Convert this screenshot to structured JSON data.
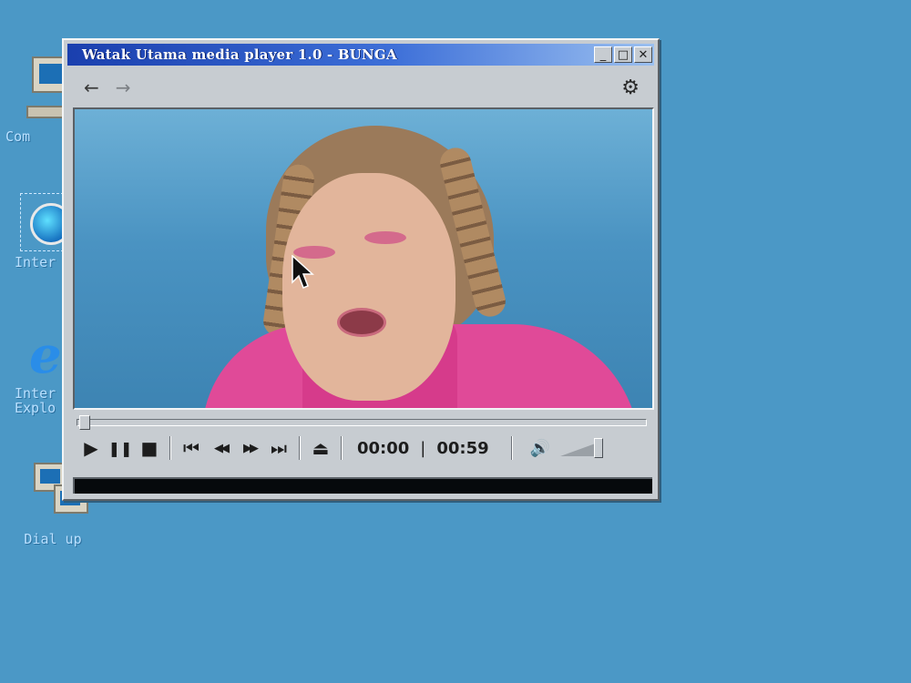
{
  "desktop": {
    "icons": [
      {
        "label": "My Computer",
        "shown": "y Com"
      },
      {
        "label": "Internet",
        "shown": "Inter"
      },
      {
        "label": "Internet Explorer",
        "shown_line1": "Inter",
        "shown_line2": "Explo"
      },
      {
        "label": "Dial up",
        "shown": "Dial up"
      }
    ]
  },
  "window": {
    "title": "Watak Utama media player 1.0 - BUNGA",
    "buttons": {
      "minimize": "_",
      "maximize": "□",
      "close": "✕"
    }
  },
  "toolbar": {
    "back_icon": "←",
    "forward_icon": "→",
    "settings_icon": "⚙"
  },
  "player": {
    "current_time": "00:00",
    "total_time": "00:59",
    "time_separator": "|",
    "progress": 0.0,
    "volume": 0.85,
    "icons": {
      "play": "▶",
      "pause": "❚❚",
      "stop": "■",
      "prev": "⏮",
      "rewind": "◀◀",
      "fast_forward": "▶▶",
      "next": "⏭",
      "eject": "⏏",
      "volume": "🔊"
    }
  },
  "colors": {
    "desktop": "#4b98c6",
    "title_bar_start": "#1a3fae",
    "title_bar_end": "#9bc0f0",
    "window_face": "#c7ccd1"
  }
}
